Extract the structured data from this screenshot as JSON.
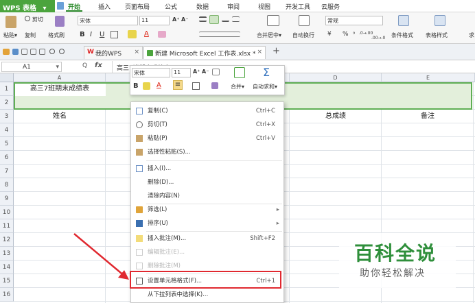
{
  "app": {
    "name": "WPS 表格",
    "dropdown_glyph": "▾"
  },
  "ribbon_tabs": [
    "开始",
    "插入",
    "页面布局",
    "公式",
    "数据",
    "审阅",
    "视图",
    "开发工具",
    "云服务"
  ],
  "ribbon": {
    "paste": "粘贴",
    "paste_arrow": "▾",
    "cut": "剪切",
    "copy": "复制",
    "format_painter": "格式刷",
    "font": "宋体",
    "font_size": "11",
    "bold": "B",
    "italic": "I",
    "underline": "U",
    "font_grow": "A⁺",
    "font_shrink": "A⁻",
    "font_color": "A",
    "merge": "合并居中",
    "merge_arrow": "▾",
    "wrap": "自动换行",
    "number_format": "常规",
    "currency": "¥",
    "percent": "%",
    "thousands": "⁹",
    "dec_inc": ".0→.00",
    "dec_dec": ".00→.0",
    "cond_format": "条件格式",
    "table_style": "表格样式",
    "more": "求"
  },
  "doc_tabs": [
    {
      "label": "我的WPS",
      "close": "×",
      "icon": "W"
    },
    {
      "label": "新建 Microsoft Excel 工作表.xlsx *",
      "close": "×"
    }
  ],
  "add_tab": "+",
  "formula_bar": {
    "name_box": "A1",
    "name_box_arrow": "▾",
    "fx": "fx",
    "zoom": "Q",
    "content": "高三7班期末成绩表"
  },
  "columns": [
    "A",
    "B",
    "C",
    "D",
    "E"
  ],
  "rows": [
    "1",
    "2",
    "3",
    "4",
    "5",
    "6",
    "7",
    "8",
    "9",
    "10",
    "11",
    "12",
    "13",
    "14",
    "15",
    "16"
  ],
  "cells": {
    "a1": "高三7班期末成绩表",
    "a3": "姓名",
    "d3": "总成绩",
    "e3": "备注"
  },
  "mini_toolbar": {
    "font": "宋体",
    "font_size": "11",
    "font_grow": "A⁺",
    "font_shrink": "A⁻",
    "bold": "B",
    "font_color": "A",
    "align": "≡",
    "merge": "合并",
    "merge_arrow": "▾",
    "autosum_symbol": "Σ",
    "autosum": "自动求和",
    "autosum_arrow": "▾"
  },
  "context_menu": {
    "items": [
      {
        "label": "复制(C)",
        "shortcut": "Ctrl+C"
      },
      {
        "label": "剪切(T)",
        "shortcut": "Ctrl+X"
      },
      {
        "label": "粘贴(P)",
        "shortcut": "Ctrl+V"
      },
      {
        "label": "选择性粘贴(S)..."
      },
      {
        "label": "插入(I)..."
      },
      {
        "label": "删除(D)..."
      },
      {
        "label": "清除内容(N)"
      },
      {
        "label": "筛选(L)",
        "arrow": "▸"
      },
      {
        "label": "排序(U)",
        "arrow": "▸"
      },
      {
        "label": "插入批注(M)...",
        "shortcut": "Shift+F2"
      },
      {
        "label": "编辑批注(E)..."
      },
      {
        "label": "删除批注(M)"
      },
      {
        "label": "设置单元格格式(F)...",
        "shortcut": "Ctrl+1"
      },
      {
        "label": "从下拉列表中选择(K)..."
      }
    ]
  },
  "watermark": {
    "title": "百科全说",
    "subtitle": "助你轻松解决"
  },
  "colors": {
    "accent_green": "#4ba43d",
    "highlight_red": "#e0282f",
    "selection": "#e3efdb",
    "selection_border": "#5fae54"
  }
}
